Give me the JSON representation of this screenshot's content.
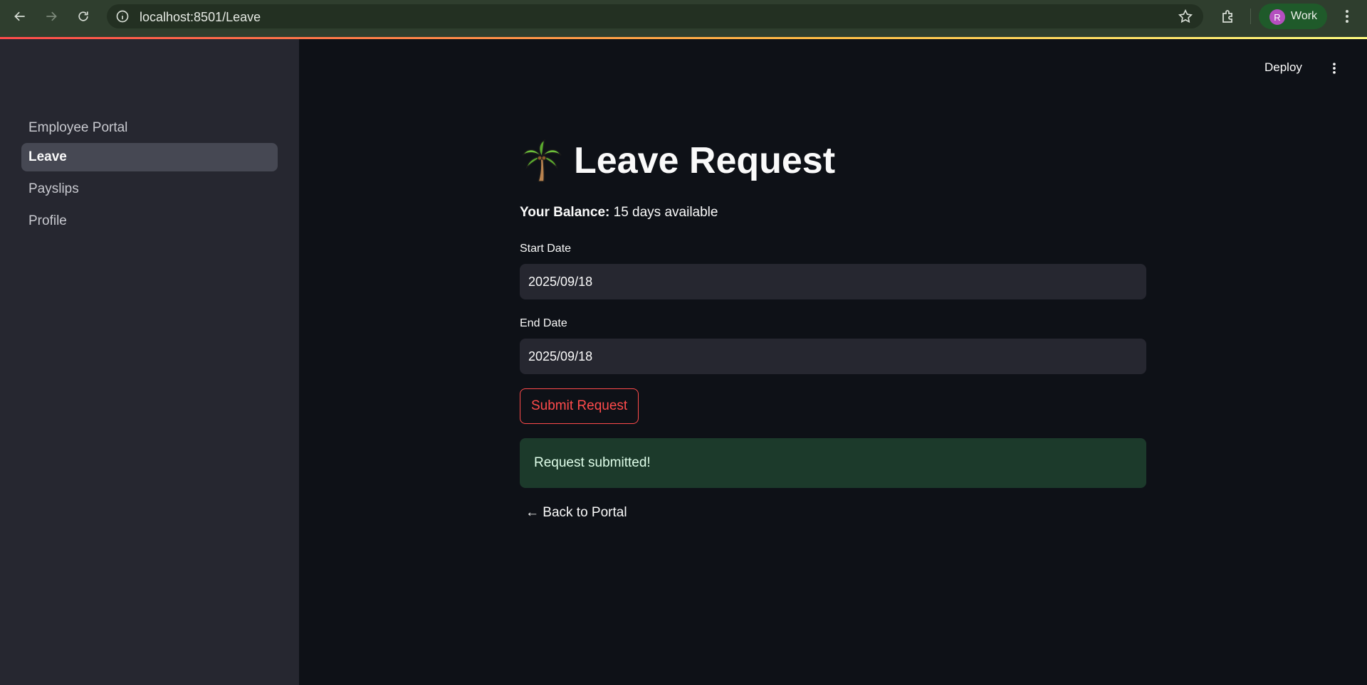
{
  "browser": {
    "url": "localhost:8501/Leave",
    "profile_initial": "R",
    "profile_label": "Work"
  },
  "sidebar": {
    "items": [
      {
        "label": "Employee Portal"
      },
      {
        "label": "Leave",
        "active": true
      },
      {
        "label": "Payslips"
      },
      {
        "label": "Profile"
      }
    ]
  },
  "toolbar": {
    "deploy_label": "Deploy"
  },
  "page": {
    "title_icon": "palm-tree-icon",
    "title": "Leave Request",
    "balance_label": "Your Balance:",
    "balance_value": "15 days available",
    "start_date_label": "Start Date",
    "start_date_value": "2025/09/18",
    "end_date_label": "End Date",
    "end_date_value": "2025/09/18",
    "submit_label": "Submit Request",
    "success_message": "Request submitted!",
    "back_link": "← Back to Portal"
  },
  "colors": {
    "accent": "#ff4b4b",
    "background": "#0e1117",
    "sidebar": "#262730",
    "success_bg": "#1c3a2b"
  }
}
